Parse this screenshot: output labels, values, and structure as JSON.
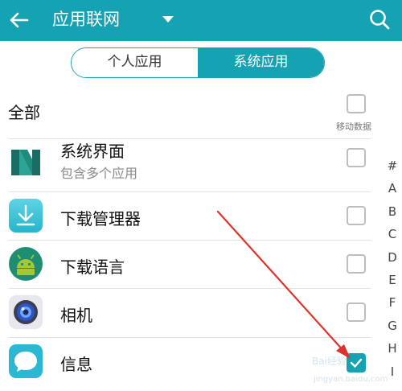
{
  "header": {
    "title": "应用联网",
    "back_icon": "back-arrow-icon",
    "search_icon": "search-icon",
    "dropdown_icon": "caret-down-icon"
  },
  "tabs": [
    {
      "label": "个人应用",
      "active": false
    },
    {
      "label": "系统应用",
      "active": true
    }
  ],
  "all_row": {
    "label": "全部",
    "column_label": "移动数据",
    "checked": false
  },
  "apps": [
    {
      "name": "系统界面",
      "subtitle": "包含多个应用",
      "icon": "system-ui-icon",
      "checked": false
    },
    {
      "name": "下载管理器",
      "subtitle": "",
      "icon": "download-manager-icon",
      "checked": false
    },
    {
      "name": "下载语言",
      "subtitle": "",
      "icon": "android-icon",
      "checked": false
    },
    {
      "name": "相机",
      "subtitle": "",
      "icon": "camera-icon",
      "checked": false
    },
    {
      "name": "信息",
      "subtitle": "",
      "icon": "messages-icon",
      "checked": true
    }
  ],
  "index_letters": [
    "#",
    "A",
    "B",
    "C",
    "D",
    "E",
    "F",
    "G",
    "H",
    "I"
  ],
  "watermark": {
    "line1": "Bai经验",
    "line2": "jingyan.baidu.com"
  },
  "colors": {
    "accent": "#15a3b4",
    "annotation": "#e0322c"
  }
}
